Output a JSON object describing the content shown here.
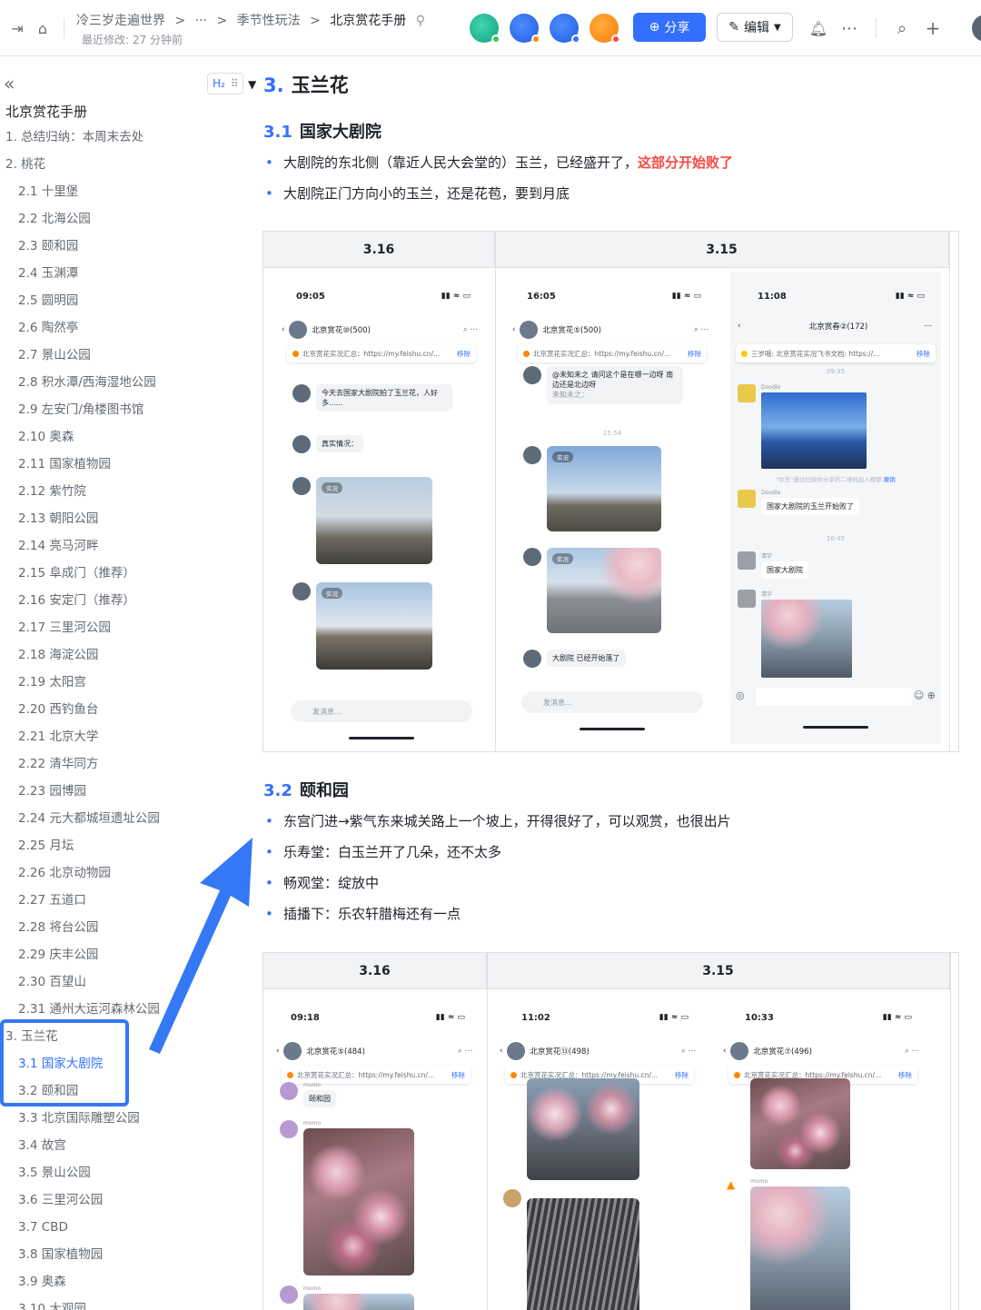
{
  "topbar": {
    "breadcrumb": [
      "冷三岁走遍世界",
      ">",
      "···",
      ">",
      "季节性玩法",
      ">"
    ],
    "current": "北京赏花手册",
    "modified": "最近修改: 27 分钟前",
    "share_label": "分享",
    "edit_label": "编辑",
    "colors": {
      "accent": "#3370ff"
    }
  },
  "sidebar": {
    "title": "北京赏花手册",
    "items": [
      {
        "label": "1. 总结归纳：本周末去处",
        "level": 1
      },
      {
        "label": "2. 桃花",
        "level": 1
      },
      {
        "label": "2.1 十里堡",
        "level": 2
      },
      {
        "label": "2.2 北海公园",
        "level": 2
      },
      {
        "label": "2.3 颐和园",
        "level": 2
      },
      {
        "label": "2.4 玉渊潭",
        "level": 2
      },
      {
        "label": "2.5 圆明园",
        "level": 2
      },
      {
        "label": "2.6 陶然亭",
        "level": 2
      },
      {
        "label": "2.7 景山公园",
        "level": 2
      },
      {
        "label": "2.8 积水潭/西海湿地公园",
        "level": 2
      },
      {
        "label": "2.9 左安门/角楼图书馆",
        "level": 2
      },
      {
        "label": "2.10 奥森",
        "level": 2
      },
      {
        "label": "2.11 国家植物园",
        "level": 2
      },
      {
        "label": "2.12 紫竹院",
        "level": 2
      },
      {
        "label": "2.13 朝阳公园",
        "level": 2
      },
      {
        "label": "2.14 亮马河畔",
        "level": 2
      },
      {
        "label": "2.15 阜成门（推荐）",
        "level": 2
      },
      {
        "label": "2.16 安定门（推荐）",
        "level": 2
      },
      {
        "label": "2.17 三里河公园",
        "level": 2
      },
      {
        "label": "2.18 海淀公园",
        "level": 2
      },
      {
        "label": "2.19 太阳宫",
        "level": 2
      },
      {
        "label": "2.20 西钓鱼台",
        "level": 2
      },
      {
        "label": "2.21 北京大学",
        "level": 2
      },
      {
        "label": "2.22 清华同方",
        "level": 2
      },
      {
        "label": "2.23 园博园",
        "level": 2
      },
      {
        "label": "2.24 元大都城垣遗址公园",
        "level": 2
      },
      {
        "label": "2.25 月坛",
        "level": 2
      },
      {
        "label": "2.26 北京动物园",
        "level": 2
      },
      {
        "label": "2.27 五道口",
        "level": 2
      },
      {
        "label": "2.28 将台公园",
        "level": 2
      },
      {
        "label": "2.29 庆丰公园",
        "level": 2
      },
      {
        "label": "2.30 百望山",
        "level": 2
      },
      {
        "label": "2.31 通州大运河森林公园",
        "level": 2
      },
      {
        "label": "3. 玉兰花",
        "level": 1
      },
      {
        "label": "3.1 国家大剧院",
        "level": 2,
        "active": true
      },
      {
        "label": "3.2 颐和园",
        "level": 2
      },
      {
        "label": "3.3 北京国际雕塑公园",
        "level": 2
      },
      {
        "label": "3.4 故宫",
        "level": 2
      },
      {
        "label": "3.5 景山公园",
        "level": 2
      },
      {
        "label": "3.6 三里河公园",
        "level": 2
      },
      {
        "label": "3.7 CBD",
        "level": 2
      },
      {
        "label": "3.8 国家植物园",
        "level": 2
      },
      {
        "label": "3.9 奥森",
        "level": 2
      },
      {
        "label": "3.10 大观园",
        "level": 2
      }
    ]
  },
  "doc": {
    "h_badge": "H₂",
    "h2": {
      "num": "3.",
      "text": "玉兰花"
    },
    "s1": {
      "num": "3.1",
      "text": "国家大剧院",
      "b1": "大剧院的东北侧（靠近人民大会堂的）玉兰，已经盛开了，",
      "b1_red": "这部分开始败了",
      "b2": "大剧院正门方向小的玉兰，还是花苞，要到月底",
      "headers": [
        "3.16",
        "3.15"
      ]
    },
    "s2": {
      "num": "3.2",
      "text": "颐和园",
      "bullets": [
        "东宫门进→紫气东来城关路上一个坡上，开得很好了，可以观赏，也很出片",
        "乐寿堂：白玉兰开了几朵，还不太多",
        "畅观堂：绽放中",
        "插播下：乐农轩腊梅还有一点"
      ],
      "headers": [
        "3.16",
        "3.15"
      ]
    }
  },
  "phones": {
    "p1": {
      "time": "09:05",
      "title": "北京赏花⑩(500)",
      "pin": "北京赏花实况汇总：https://my.feishu.cn/...",
      "remove": "移除",
      "msg1": "今天去国家大剧院拍了玉兰花，人好多......",
      "msg2": "真实情况：",
      "tag": "实况",
      "input": "发消息..."
    },
    "p2": {
      "time": "16:05",
      "title": "北京赏花⑤(500)",
      "pin": "北京赏花实况汇总：https://my.feishu.cn/...",
      "remove": "移除",
      "msg1": "@未知未之 请问这个是在哪一边呀 南边还是北边呀",
      "msg1b": "未知未之：",
      "sep": "15:54",
      "msg_last": "大剧院 已经开始落了",
      "tag": "实况",
      "input": "发消息..."
    },
    "p3": {
      "time": "11:08",
      "title": "北京赏春②(172)",
      "pin": "三岁哦: 北京赏花实况飞书文档: https://...",
      "remove": "移除",
      "sep1": "09:35",
      "name": "Doodle",
      "note": "\"尔东\"通过扫描你分享的二维码加入群聊",
      "note_link": "撤销",
      "msg1": "国家大剧院的玉兰开始败了",
      "sep2": "10:45",
      "name2": "清宇",
      "msg2": "国家大剧院"
    },
    "p4": {
      "time": "09:18",
      "title": "北京赏花⑤(484)",
      "pin": "北京赏花实况汇总：https://my.feishu.cn/...",
      "remove": "移除",
      "msg1": "颐和园",
      "name": "momo"
    },
    "p5": {
      "time": "11:02",
      "title": "北京赏花⑬(498)",
      "pin": "北京赏花实况汇总：https://my.feishu.cn/...",
      "remove": "移除"
    },
    "p6": {
      "time": "10:33",
      "title": "北京赏花⑦(496)",
      "pin": "北京赏花实况汇总：https://my.feishu.cn/...",
      "remove": "移除",
      "name": "momo"
    }
  }
}
